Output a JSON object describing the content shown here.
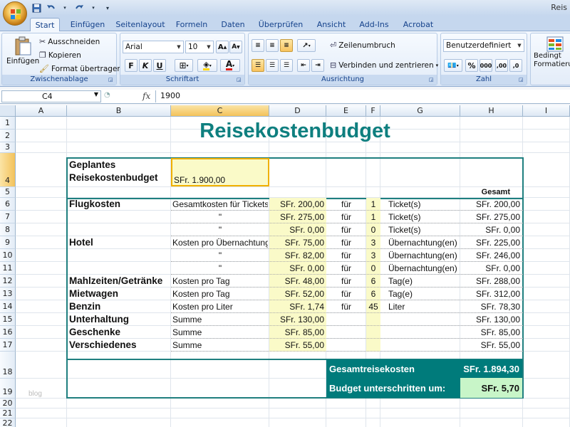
{
  "window": {
    "title": "Reis"
  },
  "qat": {
    "save": "save-icon",
    "undo": "undo-icon",
    "redo": "redo-icon"
  },
  "tabs": [
    "Start",
    "Einfügen",
    "Seitenlayout",
    "Formeln",
    "Daten",
    "Überprüfen",
    "Ansicht",
    "Add-Ins",
    "Acrobat"
  ],
  "ribbon": {
    "clipboard": {
      "label": "Zwischenablage",
      "paste": "Einfügen",
      "cut": "Ausschneiden",
      "copy": "Kopieren",
      "format_painter": "Format übertragen"
    },
    "font": {
      "label": "Schriftart",
      "name": "Arial",
      "size": "10",
      "bold": "F",
      "italic": "K",
      "underline": "U"
    },
    "alignment": {
      "label": "Ausrichtung",
      "wrap": "Zeilenumbruch",
      "merge": "Verbinden und zentrieren"
    },
    "number": {
      "label": "Zahl",
      "format": "Benutzerdefiniert",
      "percent": "%",
      "thousands": "000",
      "dec_inc": ",00",
      "dec_dec": ",0"
    },
    "styles": {
      "cond_line1": "Bedingt",
      "cond_line2": "Formatieru"
    }
  },
  "formula_bar": {
    "name_box": "C4",
    "fx": "fx",
    "value": "1900"
  },
  "columns": [
    "A",
    "B",
    "C",
    "D",
    "E",
    "F",
    "G",
    "H",
    "I"
  ],
  "rows": [
    "1",
    "2",
    "3",
    "4",
    "5",
    "6",
    "7",
    "8",
    "9",
    "10",
    "11",
    "12",
    "13",
    "14",
    "15",
    "16",
    "17",
    "18",
    "19",
    "20",
    "21",
    "22"
  ],
  "sheet": {
    "title": "Reisekostenbudget",
    "planned_label_1": "Geplantes",
    "planned_label_2": "Reisekostenbudget",
    "planned_value": "SFr. 1.900,00",
    "total_header": "Gesamt",
    "items": [
      {
        "category": "Flugkosten",
        "desc": "Gesamtkosten für Tickets",
        "cost": "SFr. 200,00",
        "fuer": "für",
        "qty": "1",
        "unit": "Ticket(s)",
        "total": "SFr. 200,00"
      },
      {
        "category": "",
        "desc": "\"",
        "cost": "SFr. 275,00",
        "fuer": "für",
        "qty": "1",
        "unit": "Ticket(s)",
        "total": "SFr. 275,00"
      },
      {
        "category": "",
        "desc": "\"",
        "cost": "SFr. 0,00",
        "fuer": "für",
        "qty": "0",
        "unit": "Ticket(s)",
        "total": "SFr. 0,00"
      },
      {
        "category": "Hotel",
        "desc": "Kosten pro Übernachtung",
        "cost": "SFr. 75,00",
        "fuer": "für",
        "qty": "3",
        "unit": "Übernachtung(en)",
        "total": "SFr. 225,00"
      },
      {
        "category": "",
        "desc": "\"",
        "cost": "SFr. 82,00",
        "fuer": "für",
        "qty": "3",
        "unit": "Übernachtung(en)",
        "total": "SFr. 246,00"
      },
      {
        "category": "",
        "desc": "\"",
        "cost": "SFr. 0,00",
        "fuer": "für",
        "qty": "0",
        "unit": "Übernachtung(en)",
        "total": "SFr. 0,00"
      },
      {
        "category": "Mahlzeiten/Getränke",
        "desc": "Kosten pro Tag",
        "cost": "SFr. 48,00",
        "fuer": "für",
        "qty": "6",
        "unit": "Tag(e)",
        "total": "SFr. 288,00"
      },
      {
        "category": "Mietwagen",
        "desc": "Kosten pro Tag",
        "cost": "SFr. 52,00",
        "fuer": "für",
        "qty": "6",
        "unit": "Tag(e)",
        "total": "SFr. 312,00"
      },
      {
        "category": "Benzin",
        "desc": "Kosten pro Liter",
        "cost": "SFr. 1,74",
        "fuer": "für",
        "qty": "45",
        "unit": "Liter",
        "total": "SFr. 78,30"
      },
      {
        "category": "Unterhaltung",
        "desc": "Summe",
        "cost": "SFr. 130,00",
        "fuer": "",
        "qty": "",
        "unit": "",
        "total": "SFr. 130,00"
      },
      {
        "category": "Geschenke",
        "desc": "Summe",
        "cost": "SFr. 85,00",
        "fuer": "",
        "qty": "",
        "unit": "",
        "total": "SFr. 85,00"
      },
      {
        "category": "Verschiedenes",
        "desc": "Summe",
        "cost": "SFr. 55,00",
        "fuer": "",
        "qty": "",
        "unit": "",
        "total": "SFr. 55,00"
      }
    ],
    "total_label": "Gesamtreisekosten",
    "total_value": "SFr. 1.894,30",
    "under_label": "Budget unterschritten um:",
    "under_value": "SFr. 5,70",
    "watermark": "blog"
  },
  "colors": {
    "teal": "#007b7b",
    "green": "#c8f5c8",
    "yellow": "#fafac8",
    "border": "#1f7f7f"
  }
}
